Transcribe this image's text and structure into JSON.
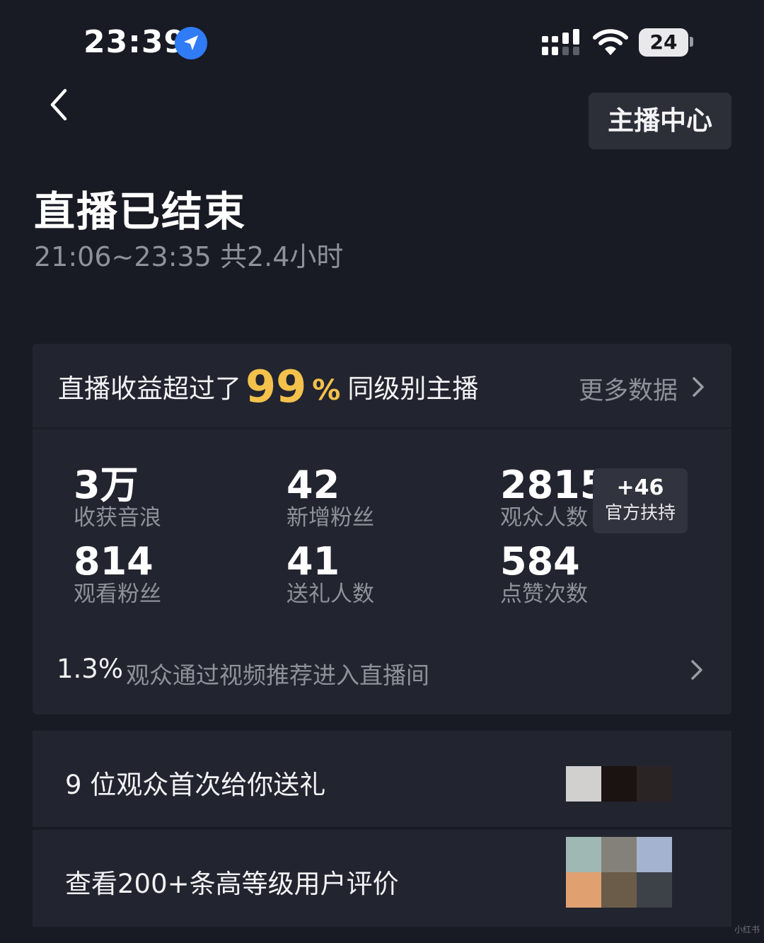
{
  "status_bar": {
    "time": "23:39",
    "battery_level": "24"
  },
  "header": {
    "anchor_center_label": "主播中心",
    "title": "直播已结束",
    "session_time": "21:06~23:35 共2.4小时"
  },
  "revenue": {
    "prefix": "直播收益超过了",
    "percent": "99",
    "percent_sign": "%",
    "suffix": "同级别主播",
    "more_data_label": "更多数据"
  },
  "stats": [
    {
      "value": "3万",
      "label": "收获音浪"
    },
    {
      "value": "42",
      "label": "新增粉丝"
    },
    {
      "value": "2815",
      "label": "观众人数"
    },
    {
      "value": "814",
      "label": "观看粉丝"
    },
    {
      "value": "41",
      "label": "送礼人数"
    },
    {
      "value": "584",
      "label": "点赞次数"
    }
  ],
  "support_badge": {
    "value": "+46",
    "label": "官方扶持"
  },
  "recommend": {
    "percent": "1.3%",
    "text": "观众通过视频推荐进入直播间"
  },
  "first_gift": {
    "text": "9 位观众首次给你送礼",
    "avatar_colors": [
      "#d2cfcf",
      "#1b1212",
      "#2a2425"
    ]
  },
  "reviews": {
    "text": "查看200+条高等级用户评价",
    "avatar_colors": [
      "#9fb8b4",
      "#84817b",
      "#a4b4d0",
      "#e0a06f",
      "#6b5c4a",
      "#3d4148"
    ]
  },
  "watermark": "小红书",
  "colors": {
    "accent_gold": "#f3c14c",
    "location_blue": "#2f7cf6",
    "background": "#181a24",
    "card": "#22242f"
  }
}
